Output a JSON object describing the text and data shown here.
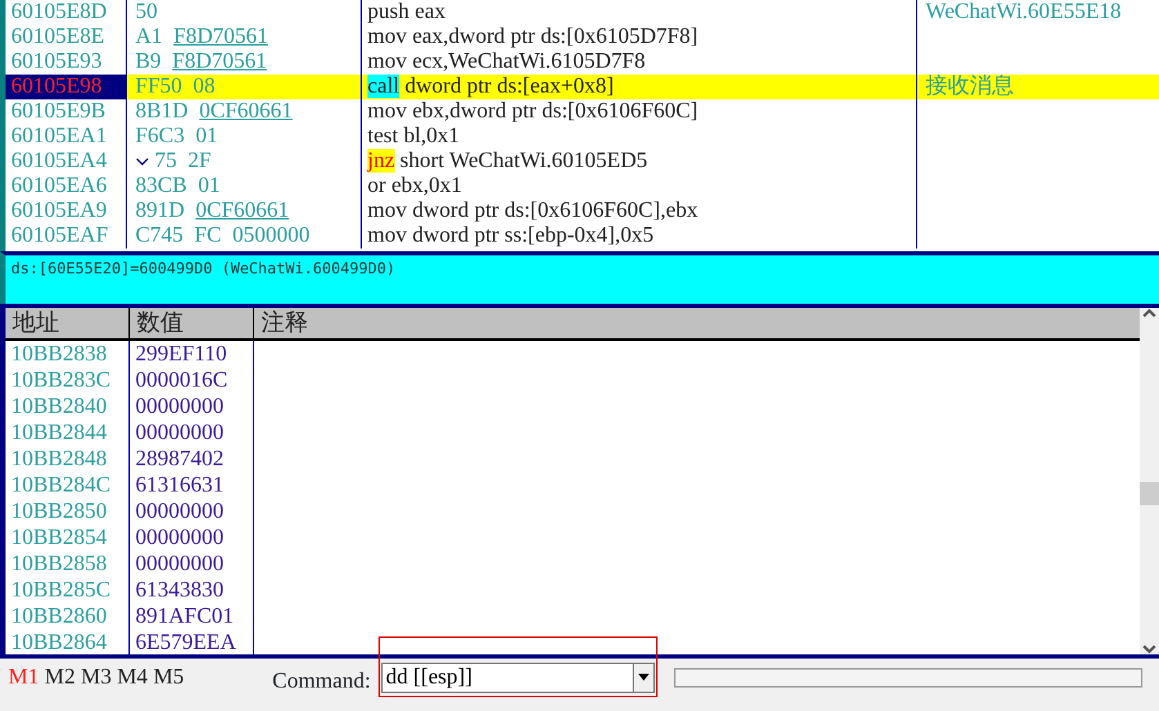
{
  "disassembly": {
    "rows": [
      {
        "address": "60105E8D",
        "bytes": [
          {
            "text": "50",
            "underlined": false
          }
        ],
        "mnemonic": "push",
        "kind": "plain",
        "operands": "eax",
        "comment": "WeChatWi.60E55E18",
        "selected": false,
        "jump_arrow": false
      },
      {
        "address": "60105E8E",
        "bytes": [
          {
            "text": "A1",
            "underlined": false
          },
          {
            "text": "F8D70561",
            "underlined": true
          }
        ],
        "mnemonic": "mov",
        "kind": "plain",
        "operands": "eax,dword ptr ds:[0x6105D7F8]",
        "selected": false,
        "jump_arrow": false
      },
      {
        "address": "60105E93",
        "bytes": [
          {
            "text": "B9",
            "underlined": false
          },
          {
            "text": "F8D70561",
            "underlined": true
          }
        ],
        "mnemonic": "mov",
        "kind": "plain",
        "operands": "ecx,WeChatWi.6105D7F8",
        "selected": false,
        "jump_arrow": false
      },
      {
        "address": "60105E98",
        "bytes": [
          {
            "text": "FF50",
            "underlined": false
          },
          {
            "text": "08",
            "underlined": false
          }
        ],
        "mnemonic": "call",
        "kind": "call",
        "operands": "dword ptr ds:[eax+0x8]",
        "comment": "接收消息",
        "selected": true,
        "jump_arrow": false
      },
      {
        "address": "60105E9B",
        "bytes": [
          {
            "text": "8B1D",
            "underlined": false
          },
          {
            "text": "0CF60661",
            "underlined": true
          }
        ],
        "mnemonic": "mov",
        "kind": "plain",
        "operands": "ebx,dword ptr ds:[0x6106F60C]",
        "selected": false,
        "jump_arrow": false
      },
      {
        "address": "60105EA1",
        "bytes": [
          {
            "text": "F6C3",
            "underlined": false
          },
          {
            "text": "01",
            "underlined": false
          }
        ],
        "mnemonic": "test",
        "kind": "plain",
        "operands": "bl,0x1",
        "selected": false,
        "jump_arrow": false
      },
      {
        "address": "60105EA4",
        "bytes": [
          {
            "text": "75",
            "underlined": false
          },
          {
            "text": "2F",
            "underlined": false
          }
        ],
        "mnemonic": "jnz",
        "kind": "jump",
        "operands": "short WeChatWi.60105ED5",
        "selected": false,
        "jump_arrow": true
      },
      {
        "address": "60105EA6",
        "bytes": [
          {
            "text": "83CB",
            "underlined": false
          },
          {
            "text": "01",
            "underlined": false
          }
        ],
        "mnemonic": "or",
        "kind": "plain",
        "operands": "ebx,0x1",
        "selected": false,
        "jump_arrow": false
      },
      {
        "address": "60105EA9",
        "bytes": [
          {
            "text": "891D",
            "underlined": false
          },
          {
            "text": "0CF60661",
            "underlined": true
          }
        ],
        "mnemonic": "mov",
        "kind": "plain",
        "operands": "dword ptr ds:[0x6106F60C],ebx",
        "selected": false,
        "jump_arrow": false
      },
      {
        "address": "60105EAF",
        "bytes": [
          {
            "text": "C745",
            "underlined": false
          },
          {
            "text": "FC",
            "underlined": false
          },
          {
            "text": "0500000",
            "underlined": false
          }
        ],
        "mnemonic": "mov",
        "kind": "plain",
        "operands": "dword ptr ss:[ebp-0x4],0x5",
        "selected": false,
        "jump_arrow": false
      }
    ]
  },
  "info_panel": {
    "text": "ds:[60E55E20]=600499D0 (WeChatWi.600499D0)"
  },
  "dump": {
    "columns": [
      "地址",
      "数值",
      "注释"
    ],
    "rows": [
      {
        "address": "10BB2838",
        "value": "299EF110"
      },
      {
        "address": "10BB283C",
        "value": "0000016C"
      },
      {
        "address": "10BB2840",
        "value": "00000000"
      },
      {
        "address": "10BB2844",
        "value": "00000000"
      },
      {
        "address": "10BB2848",
        "value": "28987402"
      },
      {
        "address": "10BB284C",
        "value": "61316631"
      },
      {
        "address": "10BB2850",
        "value": "00000000"
      },
      {
        "address": "10BB2854",
        "value": "00000000"
      },
      {
        "address": "10BB2858",
        "value": "00000000"
      },
      {
        "address": "10BB285C",
        "value": "61343830"
      },
      {
        "address": "10BB2860",
        "value": "891AFC01"
      },
      {
        "address": "10BB2864",
        "value": "6E579EEA"
      }
    ]
  },
  "command_bar": {
    "tabs": [
      {
        "label": "M1",
        "selected": true
      },
      {
        "label": "M2",
        "selected": false
      },
      {
        "label": "M3",
        "selected": false
      },
      {
        "label": "M4",
        "selected": false
      },
      {
        "label": "M5",
        "selected": false
      }
    ],
    "command_label": "Command:",
    "command_value": "dd [[esp]]",
    "highlighted": true
  }
}
